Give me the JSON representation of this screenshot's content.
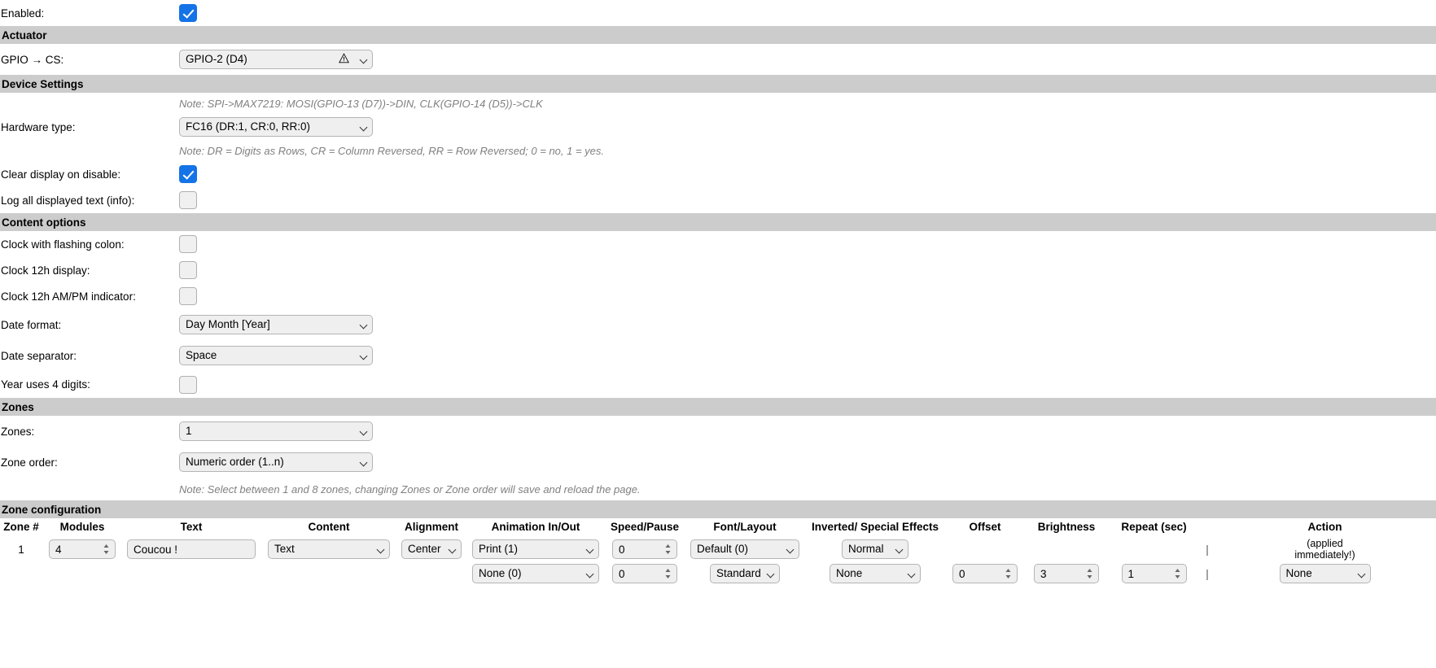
{
  "top": {
    "enabled_label": "Enabled:",
    "enabled_checked": true
  },
  "sections": {
    "actuator": "Actuator",
    "device_settings": "Device Settings",
    "content_options": "Content options",
    "zones": "Zones",
    "zone_configuration": "Zone configuration"
  },
  "actuator": {
    "gpio_cs_label": "GPIO → CS:",
    "gpio_cs_value": "GPIO-2 (D4)",
    "gpio_cs_warning_icon": "warning-triangle-icon"
  },
  "device_settings": {
    "note_spi": "Note: SPI->MAX7219: MOSI(GPIO-13 (D7))->DIN, CLK(GPIO-14 (D5))->CLK",
    "hardware_type_label": "Hardware type:",
    "hardware_type_value": "FC16 (DR:1, CR:0, RR:0)",
    "note_dr": "Note: DR = Digits as Rows, CR = Column Reversed, RR = Row Reversed; 0 = no, 1 = yes.",
    "clear_display_label": "Clear display on disable:",
    "clear_display_checked": true,
    "log_text_label": "Log all displayed text (info):",
    "log_text_checked": false
  },
  "content_options": {
    "flashing_colon_label": "Clock with flashing colon:",
    "flashing_colon_checked": false,
    "clock_12h_label": "Clock 12h display:",
    "clock_12h_checked": false,
    "ampm_label": "Clock 12h AM/PM indicator:",
    "ampm_checked": false,
    "date_format_label": "Date format:",
    "date_format_value": "Day Month [Year]",
    "date_separator_label": "Date separator:",
    "date_separator_value": "Space",
    "year_4digits_label": "Year uses 4 digits:",
    "year_4digits_checked": false
  },
  "zones": {
    "zones_label": "Zones:",
    "zones_value": "1",
    "zone_order_label": "Zone order:",
    "zone_order_value": "Numeric order (1..n)",
    "note_zones": "Note: Select between 1 and 8 zones, changing Zones or Zone order will save and reload the page."
  },
  "zone_table": {
    "headers": {
      "zone": "Zone #",
      "modules": "Modules",
      "text": "Text",
      "content": "Content",
      "alignment": "Alignment",
      "animation": "Animation In/Out",
      "speed": "Speed/Pause",
      "font": "Font/Layout",
      "inverted": "Inverted/ Special Effects",
      "offset": "Offset",
      "brightness": "Brightness",
      "repeat": "Repeat (sec)",
      "action": "Action",
      "action_sub1": "(applied",
      "action_sub2": "immediately!)",
      "separator": "|"
    },
    "row1": {
      "zone_number": "1",
      "modules": "4",
      "text": "Coucou !",
      "content": "Text",
      "alignment": "Center",
      "animation_in": "Print (1)",
      "speed": "0",
      "font": "Default (0)",
      "inverted": "Normal"
    },
    "row2": {
      "animation_out": "None (0)",
      "pause": "0",
      "layout": "Standard",
      "special_effects": "None",
      "offset": "0",
      "brightness": "3",
      "repeat": "1",
      "action": "None",
      "separator": "|"
    }
  },
  "colors": {
    "section_bar": "#cccccc",
    "checkbox_checked": "#1473e6",
    "note_text": "#808080",
    "field_bg": "#efefef"
  }
}
